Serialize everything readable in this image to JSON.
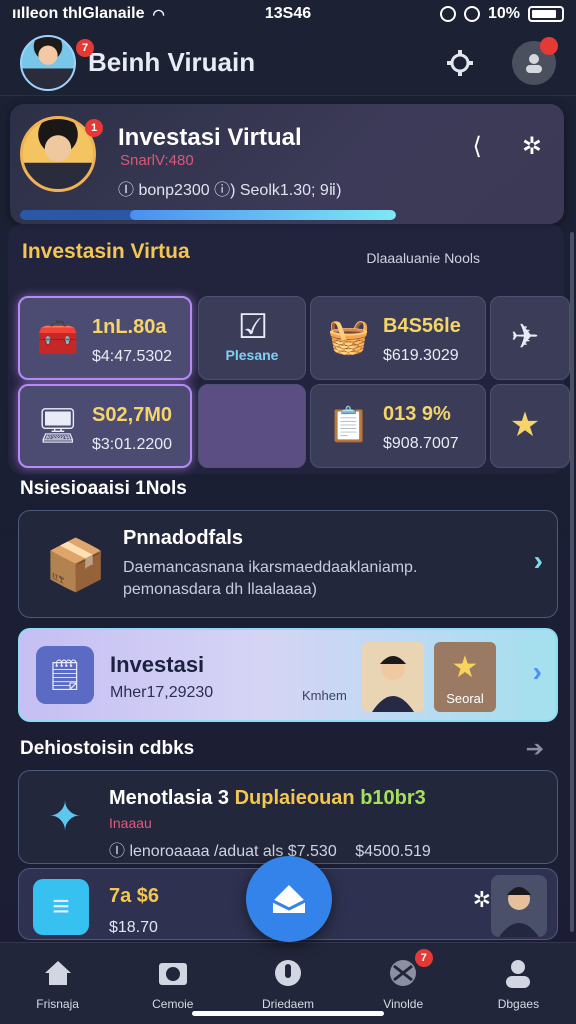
{
  "status_bar": {
    "carrier": "ıılleon thlGlanaile",
    "time": "13S46",
    "battery": "10%"
  },
  "header": {
    "title": "Beinh Viruain",
    "avatar_badge": "7"
  },
  "profile": {
    "title": "Investasi Virtual",
    "subtitle": "SnarlV:480",
    "meta": "Ⓘ bonp2300 ⓘ) Seolk1.30; 9ⅱ)",
    "badge": "1",
    "progress": 0.66
  },
  "section1": {
    "title": "Investasin Virtua",
    "note": "Dlaaaluanie Nools"
  },
  "tiles": [
    {
      "value": "1nL.80a",
      "sub": "$4:47.5302"
    },
    {
      "label": "Plesane"
    },
    {
      "value": "B4S56le",
      "sub": "$619.3029"
    },
    {
      "value": "S02,7M0",
      "sub": "$3:01.2200"
    },
    {
      "value": "013 9%",
      "sub": "$908.7007"
    }
  ],
  "section2": {
    "title": "Nsiesioaaisi 1Nols"
  },
  "promo": {
    "title": "Pnnadodfals",
    "desc1": "Daemancasnana ikarsmaeddaaklaniamp.",
    "desc2": "pemonasdara dh llaalaaaa)"
  },
  "invest": {
    "title": "Investasi",
    "sub": "Mher17,29230",
    "caption": "Kmhem",
    "mini_label": "Seoral"
  },
  "section3": {
    "title": "Dehiostoisin cdbks"
  },
  "recent": {
    "title_a": "Menotlasia 3",
    "title_b": "Duplaieouan",
    "title_c": "b10br3",
    "tag": "Inaaau",
    "meta_a": "Ⓘ lenoroaaaa /aduat als $7.530",
    "meta_b": "$4500.519"
  },
  "bottom_card": {
    "value": "7a $6",
    "sub": "$18.70"
  },
  "nav": [
    {
      "label": "Frisnaja",
      "icon": "home-icon"
    },
    {
      "label": "Cemoie",
      "icon": "camera-icon"
    },
    {
      "label": "Driedaem",
      "icon": "microphone-icon"
    },
    {
      "label": "Vinolde",
      "icon": "globe-icon",
      "badge": "7"
    },
    {
      "label": "Dbgaes",
      "icon": "person-icon"
    }
  ],
  "colors": {
    "accent": "#3483ea",
    "gold": "#f5d56a",
    "badge": "#e53935"
  }
}
